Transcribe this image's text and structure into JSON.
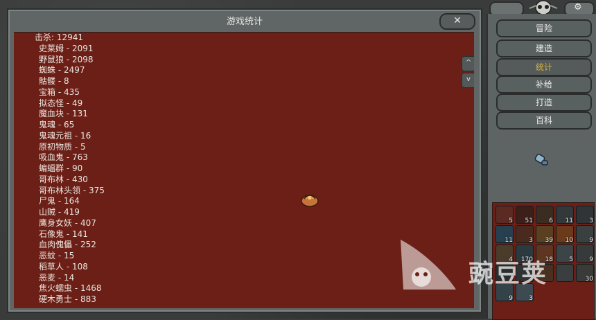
{
  "window": {
    "title": "游戏统计",
    "close_label": "✕"
  },
  "stats": {
    "header": "击杀: 12941",
    "items": [
      "史莱姆 - 2091",
      "野鼠狼 - 2098",
      "蜘蛛 - 2497",
      "骷髅 - 8",
      "宝箱 - 435",
      "拟态怪 - 49",
      "魔血块 - 131",
      "鬼魂 - 65",
      "鬼魂元祖 - 16",
      "原初物质 - 5",
      "吸血鬼 - 763",
      "蝙蝠群 - 90",
      "哥布林 - 430",
      "哥布林头领 - 375",
      "尸鬼 - 164",
      "山贼 - 419",
      "鹰身女妖 - 407",
      "石像鬼 - 141",
      "血肉傀儡 - 252",
      "恶蚊 - 15",
      "稻草人 - 108",
      "恶麦 - 14",
      "焦火蠕虫 - 1468",
      "硬木勇士 - 883"
    ]
  },
  "scroll": {
    "up": "^",
    "down": "v"
  },
  "menu": {
    "items": [
      "冒险",
      "建造",
      "统计",
      "补给",
      "打造",
      "百科"
    ],
    "active": "统计"
  },
  "inventory": {
    "counts": [
      "5",
      "51",
      "6",
      "11",
      "3",
      "11",
      "3",
      "39",
      "10",
      "9",
      "4",
      "170",
      "18",
      "5",
      "9",
      "",
      "",
      "",
      "",
      "30",
      "9",
      "3"
    ]
  },
  "watermark": {
    "text": "豌豆荚"
  },
  "icons": {
    "close": "close-icon",
    "loading": "sack-icon",
    "wrench": "wrench-icon",
    "skull": "skull-icon"
  },
  "colors": {
    "panel_red": "#6b1f17",
    "stone": "#5f6665",
    "active_menu": "#d8b23a",
    "text": "#ece7df"
  }
}
